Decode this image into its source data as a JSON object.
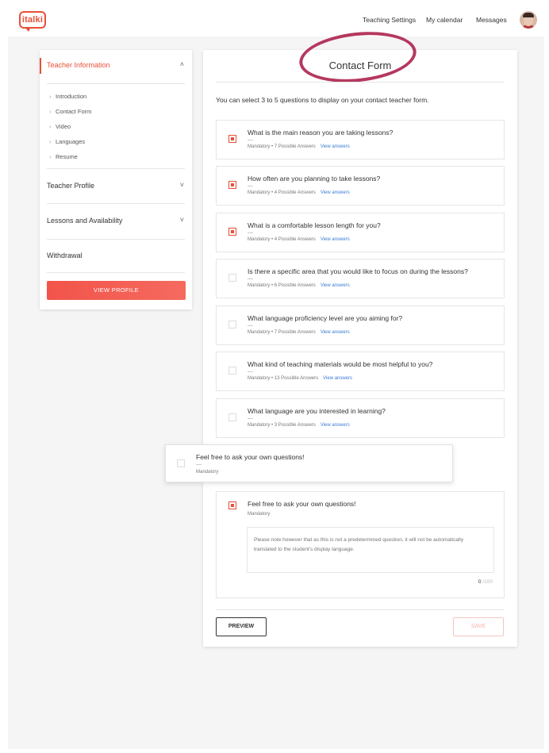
{
  "header": {
    "logo_text": "italki",
    "nav": [
      "Teaching Settings",
      "My calendar",
      "Messages"
    ],
    "avatar_icon": "user-avatar"
  },
  "sidebar": {
    "sections": [
      {
        "label": "Teacher Information",
        "chevron": "˄",
        "active": true,
        "items": [
          "Introduction",
          "Contact Form",
          "Video",
          "Languages",
          "Resume"
        ]
      },
      {
        "label": "Teacher Profile",
        "chevron": "˅"
      },
      {
        "label": "Lessons and Availability",
        "chevron": "˅"
      },
      {
        "label": "Withdrawal",
        "chevron": ""
      }
    ],
    "view_profile_label": "VIEW PROFILE"
  },
  "main": {
    "title": "Contact Form",
    "intro": "You can select 3 to 5 questions to display on your contact teacher form.",
    "questions": [
      {
        "text": "What is the main reason you are taking lessons?",
        "dash": "—",
        "meta": "Mandatory • 7 Possible Answers",
        "link": "View answers",
        "checked": true
      },
      {
        "text": "How often are you planning to take lessons?",
        "dash": "—",
        "meta": "Mandatory • 4 Possible Answers",
        "link": "View answers",
        "checked": true
      },
      {
        "text": "What is a comfortable lesson length for you?",
        "dash": "—",
        "meta": "Mandatory • 4 Possible Answers",
        "link": "View answers",
        "checked": true
      },
      {
        "text": "Is there a specific area that you would like to focus on during the lessons?",
        "dash": "—",
        "meta": "Mandatory • 6 Possible Answers",
        "link": "View answers",
        "checked": false
      },
      {
        "text": "What language proficiency level are you aiming for?",
        "dash": "—",
        "meta": "Mandatory • 7 Possible Answers",
        "link": "View answers",
        "checked": false
      },
      {
        "text": "What kind of teaching materials would be most helpful to you?",
        "dash": "—",
        "meta": "Mandatory • 13 Possible Answers",
        "link": "View answers",
        "checked": false
      },
      {
        "text": "What language are you interested in learning?",
        "dash": "—",
        "meta": "Mandatory • 3 Possible Answers",
        "link": "View answers",
        "checked": false
      }
    ],
    "floating_question": {
      "text": "Feel free to ask your own questions!",
      "dash": "—",
      "meta": "Mandatory",
      "checked": false
    },
    "own_question": {
      "text": "Feel free to ask your own questions!",
      "meta": "Mandatory",
      "checked": true,
      "placeholder": "Please note however that as this is not a predetermined question, it will not be automatically translated to the student's display language.",
      "count": "0",
      "max": "/100"
    },
    "preview_label": "PREVIEW",
    "save_label": "SAVE"
  },
  "colors": {
    "accent": "#e8503a",
    "link": "#3a7bd5",
    "annotation_ring": "#b5385e"
  }
}
